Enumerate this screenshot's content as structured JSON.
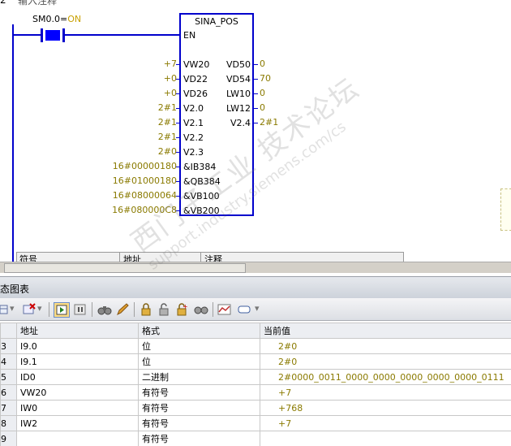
{
  "editor": {
    "network_number": "2",
    "network_comment": "输入注释",
    "contact_label": "SM0.0",
    "contact_state": "ON",
    "block_name": "SINA_POS",
    "block_en": "EN",
    "inputs": [
      {
        "pin": "VW20",
        "value": "+7"
      },
      {
        "pin": "VD22",
        "value": "+0"
      },
      {
        "pin": "VD26",
        "value": "+0"
      },
      {
        "pin": "V2.0",
        "value": "2#1"
      },
      {
        "pin": "V2.1",
        "value": "2#1"
      },
      {
        "pin": "V2.2",
        "value": "2#1"
      },
      {
        "pin": "V2.3",
        "value": "2#0"
      },
      {
        "pin": "&IB384",
        "value": "16#00000180"
      },
      {
        "pin": "&QB384",
        "value": "16#01000180"
      },
      {
        "pin": "&VB100",
        "value": "16#08000064"
      },
      {
        "pin": "&VB200",
        "value": "16#080000C8"
      }
    ],
    "outputs": [
      {
        "pin": "VD50",
        "value": "0"
      },
      {
        "pin": "VD54",
        "value": "70"
      },
      {
        "pin": "LW10",
        "value": "0"
      },
      {
        "pin": "LW12",
        "value": "0"
      },
      {
        "pin": "V2.4",
        "value": "2#1"
      }
    ],
    "symbol_table_headers": [
      "符号",
      "地址",
      "注释"
    ]
  },
  "status_chart": {
    "title": "态图表",
    "columns": [
      "地址",
      "格式",
      "当前值"
    ],
    "rows": [
      {
        "num": "3",
        "address": "I9.0",
        "format": "位",
        "value": "2#0"
      },
      {
        "num": "4",
        "address": "I9.1",
        "format": "位",
        "value": "2#0"
      },
      {
        "num": "5",
        "address": "ID0",
        "format": "二进制",
        "value": "2#0000_0011_0000_0000_0000_0000_0000_0111"
      },
      {
        "num": "6",
        "address": "VW20",
        "format": "有符号",
        "value": "+7"
      },
      {
        "num": "7",
        "address": "IW0",
        "format": "有符号",
        "value": "+768"
      },
      {
        "num": "8",
        "address": "IW2",
        "format": "有符号",
        "value": "+7"
      },
      {
        "num": "9",
        "address": "",
        "format": "有符号",
        "value": ""
      }
    ]
  },
  "toolbar": {
    "icons": [
      "table-icon",
      "delete-row-icon",
      "chart-run-icon",
      "chart-pause-icon",
      "binoculars-icon",
      "pencil-icon",
      "lock-icon",
      "unlock-icon",
      "unlock-all-icon",
      "read-all-icon",
      "trend-chart-icon",
      "tag-icon"
    ]
  },
  "watermark": {
    "text_cn": "西门子工业 技术论坛",
    "url": "support.industry.siemens.com/cs"
  },
  "colors": {
    "wire": "#0000cc",
    "value": "#8a7a00",
    "contact_on": "#c8a000"
  }
}
